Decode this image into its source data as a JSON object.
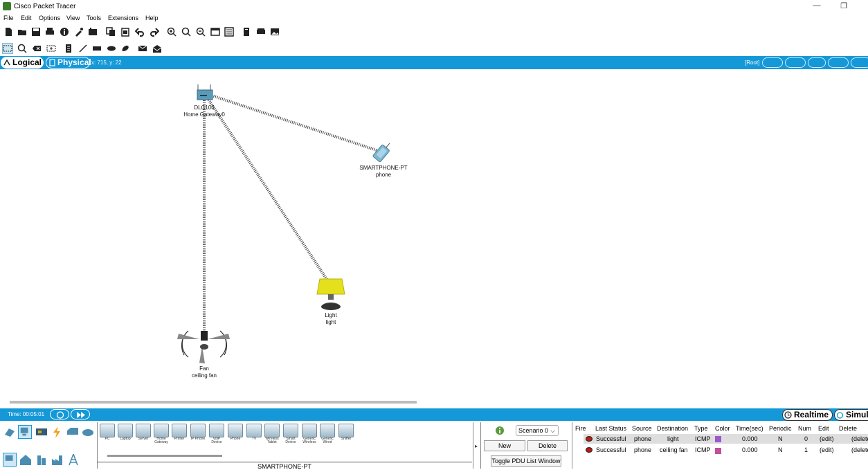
{
  "window": {
    "title": "Cisco Packet Tracer",
    "minimize": "—",
    "restore": "❐"
  },
  "menu": [
    "File",
    "Edit",
    "Options",
    "View",
    "Tools",
    "Extensions",
    "Help"
  ],
  "tabs": {
    "logical": "Logical",
    "physical": "Physical",
    "coords": "x: 715, y: 22",
    "root": "[Root]"
  },
  "devices": {
    "gateway": {
      "model": "DLC100",
      "name": "Home Gateway0"
    },
    "phone": {
      "model": "SMARTPHONE-PT",
      "name": "phone"
    },
    "light": {
      "model": "Light",
      "name": "light"
    },
    "fan": {
      "model": "Fan",
      "name": "ceiling fan"
    }
  },
  "bottom": {
    "time": "Time: 00:05:01",
    "realtime": "Realtime",
    "simulation": "Simulation"
  },
  "device_tiles": [
    "PC",
    "Laptop",
    "Server",
    "Home Gateway",
    "Printer",
    "IP Phone",
    "VoIP Device",
    "Phone",
    "TV",
    "Wireless Tablet",
    "Smart Device",
    "Generic Wireless",
    "Generic Wired",
    "Sniffer"
  ],
  "selected_device": "SMARTPHONE-PT",
  "scenario": {
    "selected": "Scenario 0",
    "new": "New",
    "delete": "Delete",
    "toggle": "Toggle PDU List Window"
  },
  "pdu": {
    "headers": [
      "Fire",
      "Last Status",
      "Source",
      "Destination",
      "Type",
      "Color",
      "Time(sec)",
      "Periodic",
      "Num",
      "Edit",
      "Delete"
    ],
    "rows": [
      {
        "status": "Successful",
        "source": "phone",
        "destination": "light",
        "type": "ICMP",
        "color": "#9b59c9",
        "time": "0.000",
        "periodic": "N",
        "num": "0",
        "edit": "(edit)",
        "delete": "(delete)"
      },
      {
        "status": "Successful",
        "source": "phone",
        "destination": "ceiling fan",
        "type": "ICMP",
        "color": "#c0509a",
        "time": "0.000",
        "periodic": "N",
        "num": "1",
        "edit": "(edit)",
        "delete": "(delete)"
      }
    ]
  },
  "colors": {
    "accent": "#1598d8"
  }
}
